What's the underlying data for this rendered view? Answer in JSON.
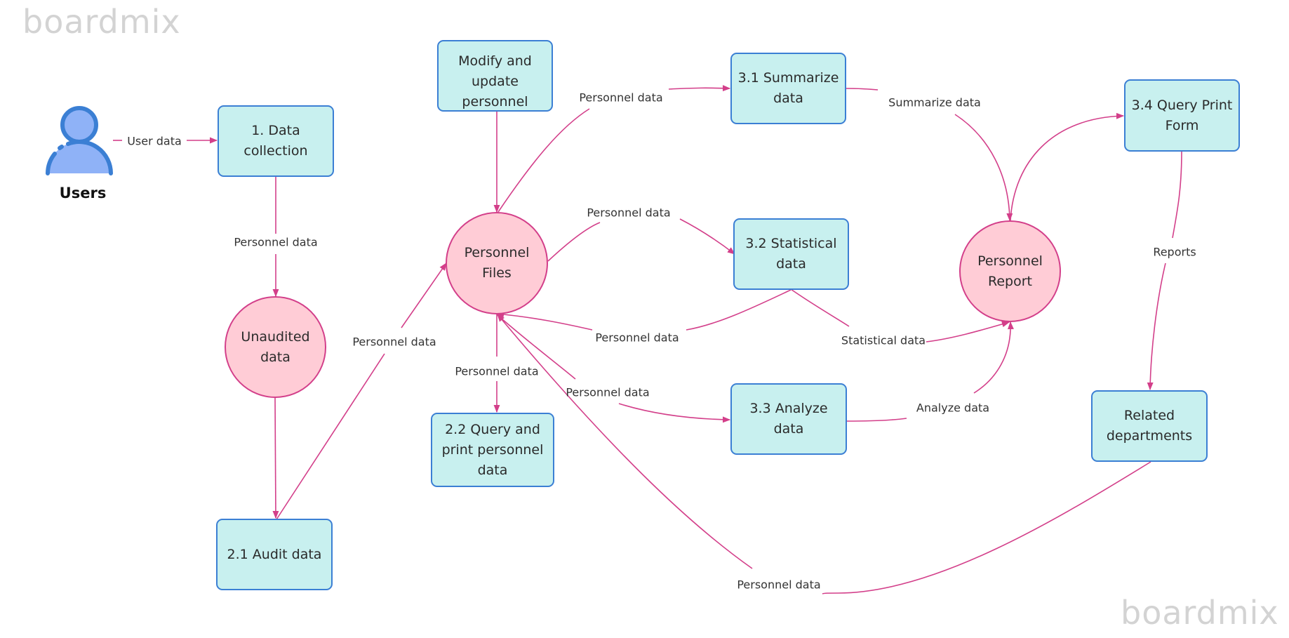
{
  "watermark": "boardmix",
  "colors": {
    "process_fill": "#c8f0ef",
    "process_stroke": "#3b7fd4",
    "store_fill": "#ffccd6",
    "store_stroke": "#d33f8a",
    "flow_line": "#d33f8a",
    "user_icon": "#3b7fd4",
    "user_icon_fill": "#8fb2f7"
  },
  "external_entity": {
    "label": "Users",
    "icon": "user-icon"
  },
  "nodes": {
    "data_collection": "1.  Data collection",
    "modify_update": "Modify and update personnel data",
    "unaudited": "Unaudited data",
    "audit": "2.1 Audit data",
    "personnel_files": "Personnel Files",
    "query_print_personnel": "2.2 Query and print personnel data",
    "summarize": "3.1 Summarize data",
    "statistical": "3.2 Statistical data",
    "analyze": "3.3 Analyze data",
    "personnel_report": "Personnel Report",
    "query_print_form": "3.4 Query Print Form",
    "related_departments": "Related departments"
  },
  "flows": [
    {
      "id": "f1",
      "from": "Users",
      "to": "1. Data collection",
      "label": "User data"
    },
    {
      "id": "f2",
      "from": "1. Data collection",
      "to": "Unaudited data",
      "label": "Personnel data"
    },
    {
      "id": "f3",
      "from": "Unaudited data",
      "to": "2.1 Audit data",
      "label": ""
    },
    {
      "id": "f4",
      "from": "2.1 Audit data",
      "to": "Personnel Files",
      "label": "Personnel data"
    },
    {
      "id": "f5",
      "from": "Modify and update personnel data",
      "to": "Personnel Files",
      "label": ""
    },
    {
      "id": "f6",
      "from": "Personnel Files",
      "to": "3.1 Summarize data",
      "label": "Personnel data"
    },
    {
      "id": "f7",
      "from": "Personnel Files",
      "to": "3.2 Statistical data",
      "label": "Personnel data"
    },
    {
      "id": "f8",
      "from": "3.2 Statistical data",
      "to": "Personnel Files",
      "label": "Personnel data"
    },
    {
      "id": "f9",
      "from": "Personnel Files",
      "to": "2.2 Query and print personnel data",
      "label": "Personnel data"
    },
    {
      "id": "f10",
      "from": "Personnel Files",
      "to": "3.3 Analyze data",
      "label": "Personnel data"
    },
    {
      "id": "f11",
      "from": "Related departments",
      "to": "Personnel Files",
      "label": "Personnel data"
    },
    {
      "id": "f12",
      "from": "3.1 Summarize data",
      "to": "Personnel Report",
      "label": "Summarize data"
    },
    {
      "id": "f13",
      "from": "3.2 Statistical data",
      "to": "Personnel Report",
      "label": "Statistical data"
    },
    {
      "id": "f14",
      "from": "3.3 Analyze data",
      "to": "Personnel Report",
      "label": "Analyze data"
    },
    {
      "id": "f15",
      "from": "Personnel Report",
      "to": "3.4 Query Print Form",
      "label": ""
    },
    {
      "id": "f16",
      "from": "3.4 Query Print Form",
      "to": "Related departments",
      "label": "Reports"
    }
  ]
}
